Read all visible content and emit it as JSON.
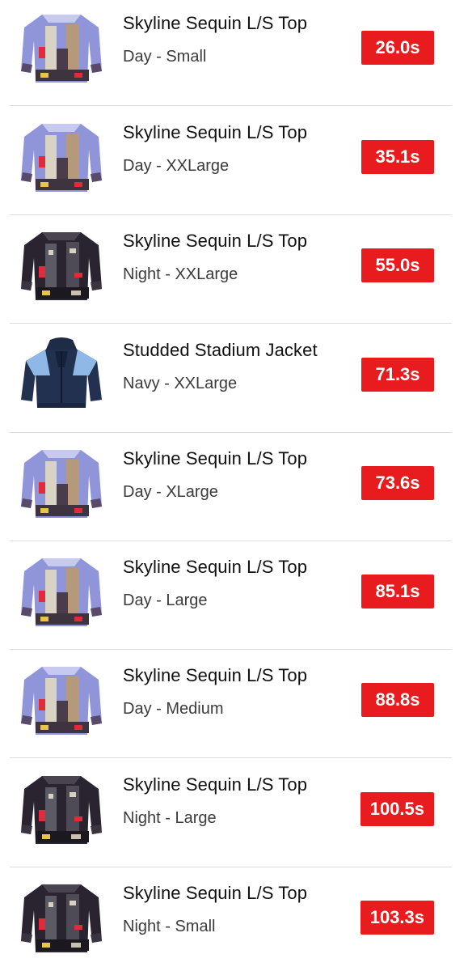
{
  "items": [
    {
      "title": "Skyline Sequin L/S Top",
      "variant": "Day - Small",
      "time": "26.0s",
      "image": "day-sequin-top-icon"
    },
    {
      "title": "Skyline Sequin L/S Top",
      "variant": "Day - XXLarge",
      "time": "35.1s",
      "image": "day-sequin-top-icon"
    },
    {
      "title": "Skyline Sequin L/S Top",
      "variant": "Night - XXLarge",
      "time": "55.0s",
      "image": "night-sequin-top-icon"
    },
    {
      "title": "Studded Stadium Jacket",
      "variant": "Navy - XXLarge",
      "time": "71.3s",
      "image": "navy-stadium-jacket-icon"
    },
    {
      "title": "Skyline Sequin L/S Top",
      "variant": "Day - XLarge",
      "time": "73.6s",
      "image": "day-sequin-top-icon"
    },
    {
      "title": "Skyline Sequin L/S Top",
      "variant": "Day - Large",
      "time": "85.1s",
      "image": "day-sequin-top-icon"
    },
    {
      "title": "Skyline Sequin L/S Top",
      "variant": "Day - Medium",
      "time": "88.8s",
      "image": "day-sequin-top-icon"
    },
    {
      "title": "Skyline Sequin L/S Top",
      "variant": "Night - Large",
      "time": "100.5s",
      "image": "night-sequin-top-icon"
    },
    {
      "title": "Skyline Sequin L/S Top",
      "variant": "Night - Small",
      "time": "103.3s",
      "image": "night-sequin-top-icon"
    }
  ],
  "colors": {
    "badge": "#e81c1f",
    "divider": "#dcdcdc"
  }
}
